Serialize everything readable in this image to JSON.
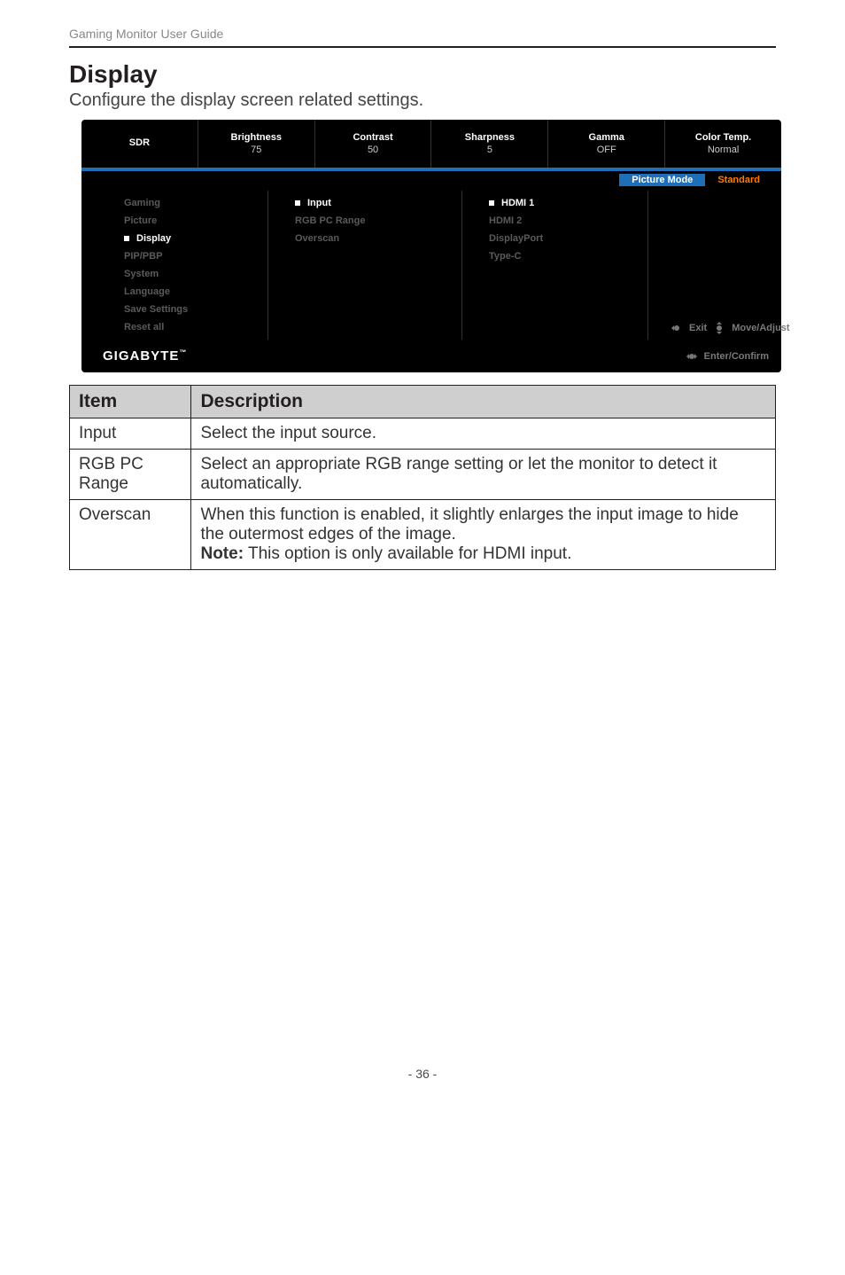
{
  "header": {
    "guide_title": "Gaming Monitor User Guide"
  },
  "section": {
    "title": "Display",
    "description": "Configure the display screen related settings."
  },
  "osd": {
    "top": [
      {
        "label": "SDR",
        "value": ""
      },
      {
        "label": "Brightness",
        "value": "75"
      },
      {
        "label": "Contrast",
        "value": "50"
      },
      {
        "label": "Sharpness",
        "value": "5"
      },
      {
        "label": "Gamma",
        "value": "OFF"
      },
      {
        "label": "Color Temp.",
        "value": "Normal"
      }
    ],
    "modebar": {
      "picture_mode_label": "Picture Mode",
      "picture_mode_value": "Standard"
    },
    "main_menu": [
      {
        "label": "Gaming",
        "active": false
      },
      {
        "label": "Picture",
        "active": false
      },
      {
        "label": "Display",
        "active": true
      },
      {
        "label": "PIP/PBP",
        "active": false
      },
      {
        "label": "System",
        "active": false
      },
      {
        "label": "Language",
        "active": false
      },
      {
        "label": "Save Settings",
        "active": false
      },
      {
        "label": "Reset all",
        "active": false
      }
    ],
    "sub_menu": [
      {
        "label": "Input",
        "active": true
      },
      {
        "label": "RGB PC Range",
        "active": false
      },
      {
        "label": "Overscan",
        "active": false
      }
    ],
    "values_menu": [
      {
        "label": "HDMI 1",
        "active": true
      },
      {
        "label": "HDMI 2",
        "active": false
      },
      {
        "label": "DisplayPort",
        "active": false
      },
      {
        "label": "Type-C",
        "active": false
      }
    ],
    "hints": {
      "exit": "Exit",
      "move": "Move/Adjust",
      "confirm": "Enter/Confirm"
    },
    "brand": "GIGABYTE"
  },
  "table": {
    "headers": {
      "item": "Item",
      "description": "Description"
    },
    "rows": [
      {
        "item": "Input",
        "description": "Select the input source."
      },
      {
        "item": "RGB PC Range",
        "description": "Select an appropriate RGB range setting or let the monitor to detect it automatically."
      },
      {
        "item": "Overscan",
        "description": "When this function is enabled, it slightly enlarges the input image to hide the outermost edges of the image.",
        "note_label": "Note:",
        "note_text": " This option is only available for HDMI input."
      }
    ]
  },
  "footer": {
    "page": "- 36 -"
  }
}
